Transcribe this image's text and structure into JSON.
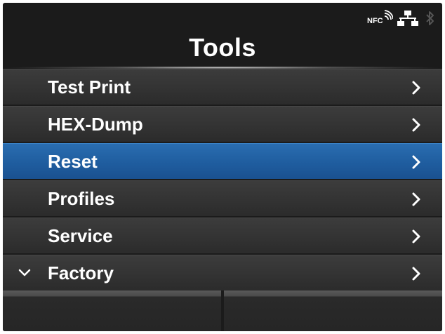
{
  "status_icons": [
    "nfc-icon",
    "network-icon",
    "bluetooth-icon"
  ],
  "nfc_label": "NFC",
  "title": "Tools",
  "menu": {
    "items": [
      {
        "label": "Test Print",
        "selected": false,
        "icon": "chevron-right-icon"
      },
      {
        "label": "HEX-Dump",
        "selected": false,
        "icon": "chevron-right-icon"
      },
      {
        "label": "Reset",
        "selected": true,
        "icon": "chevron-right-icon"
      },
      {
        "label": "Profiles",
        "selected": false,
        "icon": "chevron-right-icon"
      },
      {
        "label": "Service",
        "selected": false,
        "icon": "chevron-right-icon"
      },
      {
        "label": "Factory",
        "selected": false,
        "icon": "chevron-right-icon"
      }
    ],
    "scroll_indicator_icon": "chevron-down-icon"
  },
  "softkeys": [
    "",
    ""
  ],
  "colors": {
    "background": "#1b1b1b",
    "item": "#363636",
    "selected": "#1f5d9f",
    "text": "#ffffff"
  }
}
